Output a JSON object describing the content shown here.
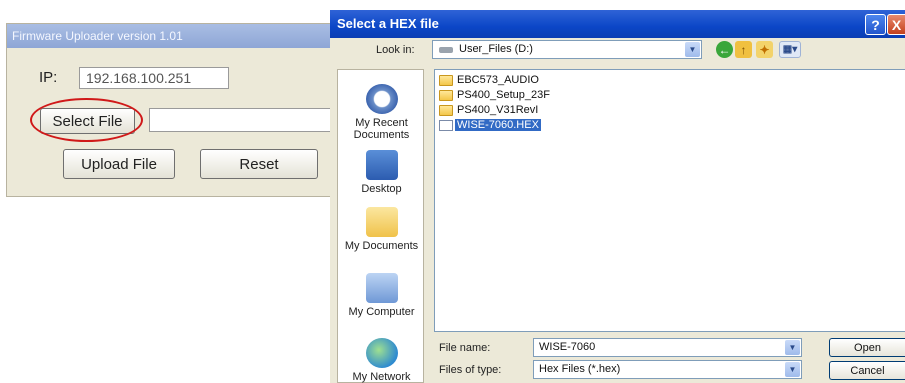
{
  "uploader": {
    "title": "Firmware Uploader version 1.01",
    "ip_label": "IP:",
    "ip_value": "192.168.100.251",
    "select_file_label": "Select File",
    "file_path_value": "",
    "upload_label": "Upload File",
    "reset_label": "Reset",
    "highlight_color": "#d01919"
  },
  "dialog": {
    "title": "Select a HEX file",
    "help_label": "?",
    "close_label": "X",
    "look_in_label": "Look in:",
    "look_in_value": "User_Files (D:)",
    "toolbar_icons": [
      "back-icon",
      "up-folder-icon",
      "new-folder-icon",
      "views-menu-icon"
    ],
    "places": [
      {
        "label": "My Recent\nDocuments",
        "icon": "recent-documents-icon"
      },
      {
        "label": "Desktop",
        "icon": "desktop-icon"
      },
      {
        "label": "My Documents",
        "icon": "my-documents-icon"
      },
      {
        "label": "My Computer",
        "icon": "my-computer-icon"
      },
      {
        "label": "My Network",
        "icon": "my-network-icon"
      }
    ],
    "files": [
      {
        "name": "EBC573_AUDIO",
        "type": "folder",
        "selected": false
      },
      {
        "name": "PS400_Setup_23F",
        "type": "folder",
        "selected": false
      },
      {
        "name": "PS400_V31RevI",
        "type": "folder",
        "selected": false
      },
      {
        "name": "WISE-7060.HEX",
        "type": "hex",
        "selected": true
      }
    ],
    "file_name_label": "File name:",
    "file_name_value": "WISE-7060",
    "file_type_label": "Files of type:",
    "file_type_value": "Hex Files (*.hex)",
    "open_label": "Open",
    "cancel_label": "Cancel",
    "title_bar_color": "#0b46c7",
    "selection_color": "#316ac5"
  }
}
